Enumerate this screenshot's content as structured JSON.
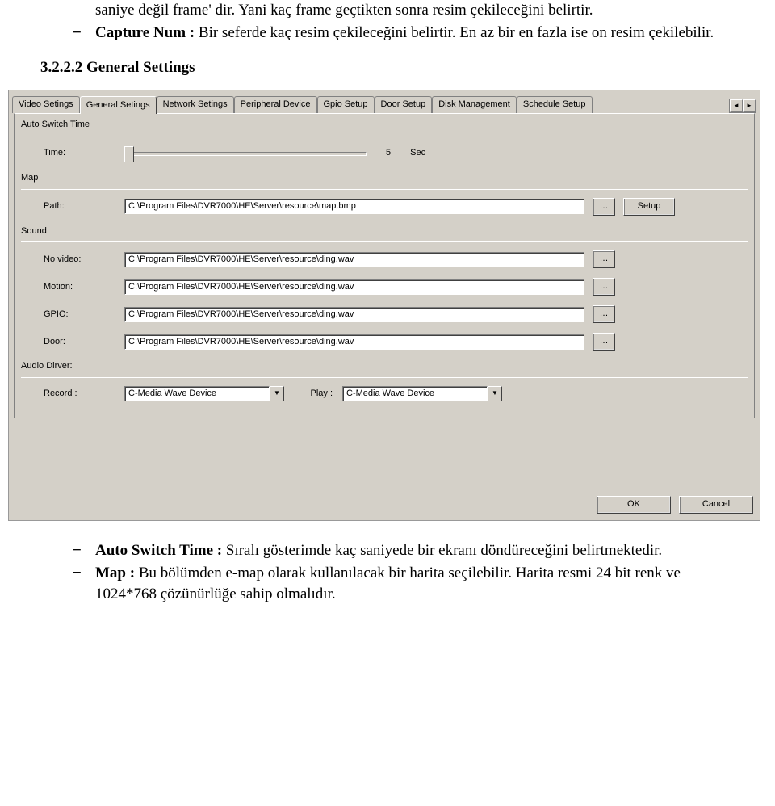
{
  "para_pre": "saniye değil frame' dir. Yani kaç frame geçtikten sonra resim çekileceğini belirtir.",
  "bullet_capture": {
    "label": "Capture Num :",
    "text": " Bir seferde kaç resim çekileceğini belirtir. En az bir en fazla ise on resim çekilebilir."
  },
  "heading": "3.2.2.2 General Settings",
  "app": {
    "tabs": [
      "Video Setings",
      "General Setings",
      "Network Setings",
      "Peripheral Device",
      "Gpio Setup",
      "Door Setup",
      "Disk Management",
      "Schedule Setup"
    ],
    "active_tab": 1,
    "spinner": {
      "left": "◄",
      "right": "►"
    },
    "groups": {
      "auto_switch": {
        "title": "Auto Switch Time",
        "time_label": "Time:",
        "value": "5",
        "unit": "Sec"
      },
      "map": {
        "title": "Map",
        "path_label": "Path:",
        "path_value": "C:\\Program Files\\DVR7000\\HE\\Server\\resource\\map.bmp",
        "browse": "…",
        "setup": "Setup"
      },
      "sound": {
        "title": "Sound",
        "rows": [
          {
            "label": "No video:",
            "value": "C:\\Program Files\\DVR7000\\HE\\Server\\resource\\ding.wav"
          },
          {
            "label": "Motion:",
            "value": "C:\\Program Files\\DVR7000\\HE\\Server\\resource\\ding.wav"
          },
          {
            "label": "GPIO:",
            "value": "C:\\Program Files\\DVR7000\\HE\\Server\\resource\\ding.wav"
          },
          {
            "label": "Door:",
            "value": "C:\\Program Files\\DVR7000\\HE\\Server\\resource\\ding.wav"
          }
        ],
        "browse": "…"
      },
      "audio_driver": {
        "title": "Audio Dirver:",
        "record_label": "Record :",
        "record_value": "C-Media Wave Device",
        "play_label": "Play :",
        "play_value": "C-Media Wave Device"
      }
    },
    "ok": "OK",
    "cancel": "Cancel"
  },
  "bullets_after": [
    {
      "label": "Auto Switch Time :",
      "text": " Sıralı gösterimde kaç saniyede bir ekranı döndüreceğini belirtmektedir."
    },
    {
      "label": "Map :",
      "text": " Bu bölümden e-map olarak kullanılacak bir harita seçilebilir. Harita resmi 24 bit renk ve 1024*768 çözünürlüğe sahip olmalıdır."
    }
  ]
}
